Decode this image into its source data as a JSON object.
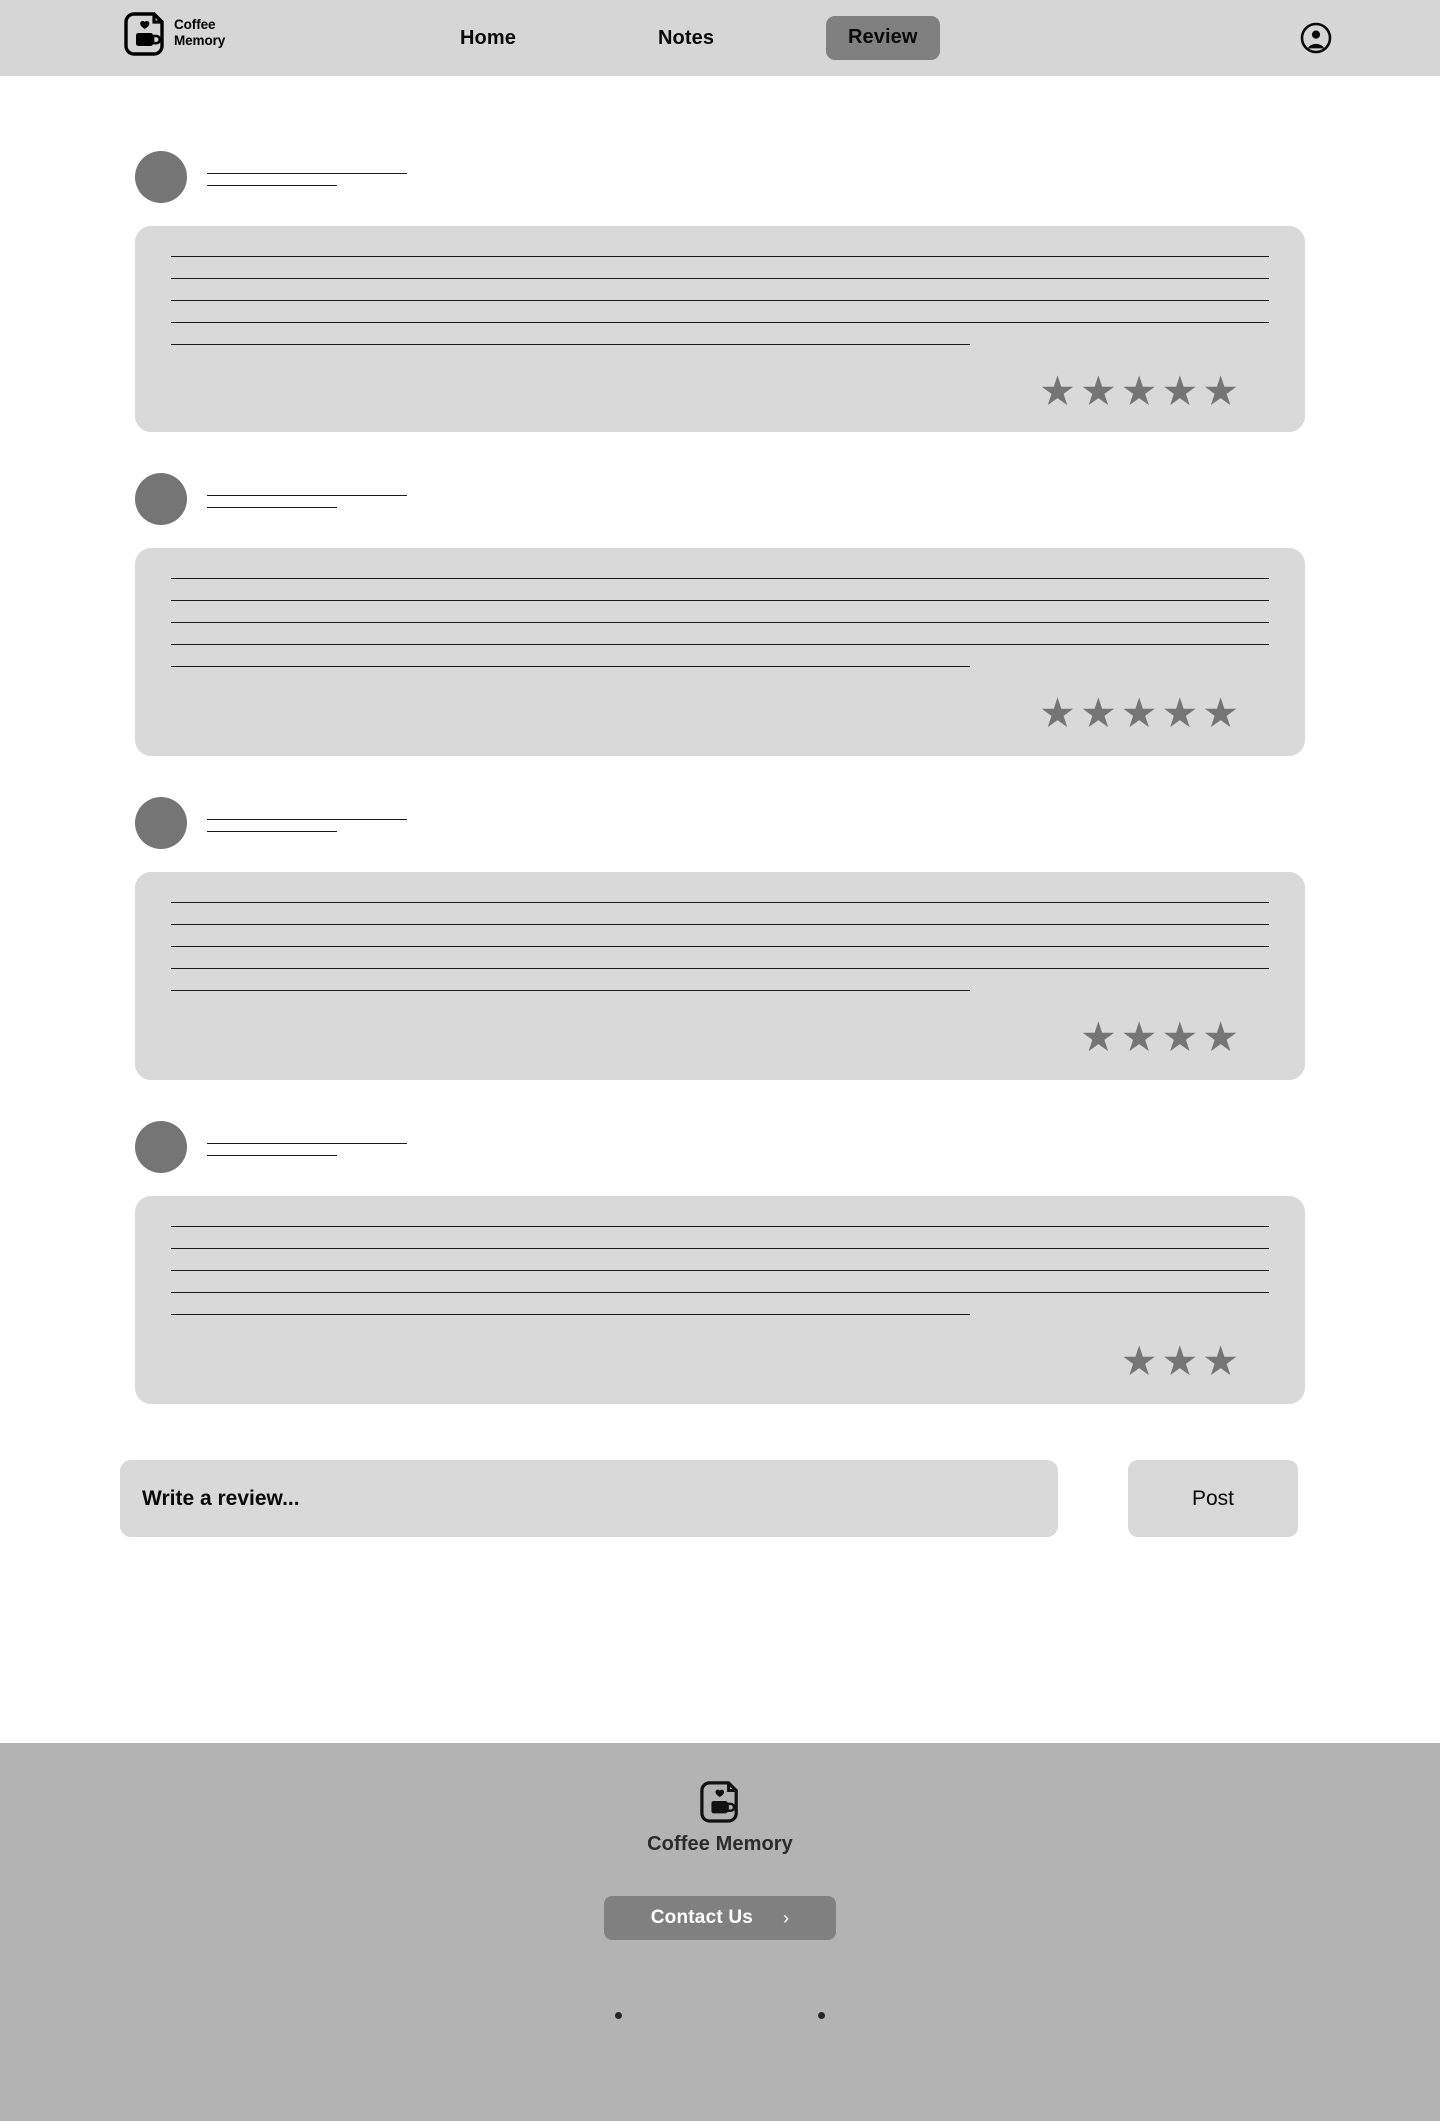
{
  "brand": {
    "name_line1": "Coffee",
    "name_line2": "Memory",
    "logo_icon": "coffee-note-logo-icon"
  },
  "header": {
    "nav": [
      {
        "label": "Home",
        "active": false
      },
      {
        "label": "Notes",
        "active": false
      },
      {
        "label": "Review",
        "active": true
      }
    ],
    "account_icon": "account-circle-icon",
    "background_color": "#D6D6D6",
    "active_tab_color": "#808080"
  },
  "reviews": [
    {
      "stars": 5,
      "star_glyph": "★",
      "placeholder_lines": 5
    },
    {
      "stars": 5,
      "star_glyph": "★",
      "placeholder_lines": 5
    },
    {
      "stars": 4,
      "star_glyph": "★",
      "placeholder_lines": 5
    },
    {
      "stars": 3,
      "star_glyph": "★",
      "placeholder_lines": 5
    }
  ],
  "compose": {
    "placeholder": "Write a review...",
    "value": "",
    "post_label": "Post"
  },
  "footer": {
    "logo_icon": "coffee-note-logo-icon",
    "brand_name": "Coffee Memory",
    "contact_label": "Contact Us",
    "contact_chevron": "›",
    "dots": 2,
    "background_color": "#B3B3B3",
    "button_color": "#808080"
  },
  "colors": {
    "card_background": "#D9D9D9",
    "avatar": "#757575",
    "star": "#757575",
    "line": "#1B1B1B",
    "page_background": "#FFFFFF"
  }
}
